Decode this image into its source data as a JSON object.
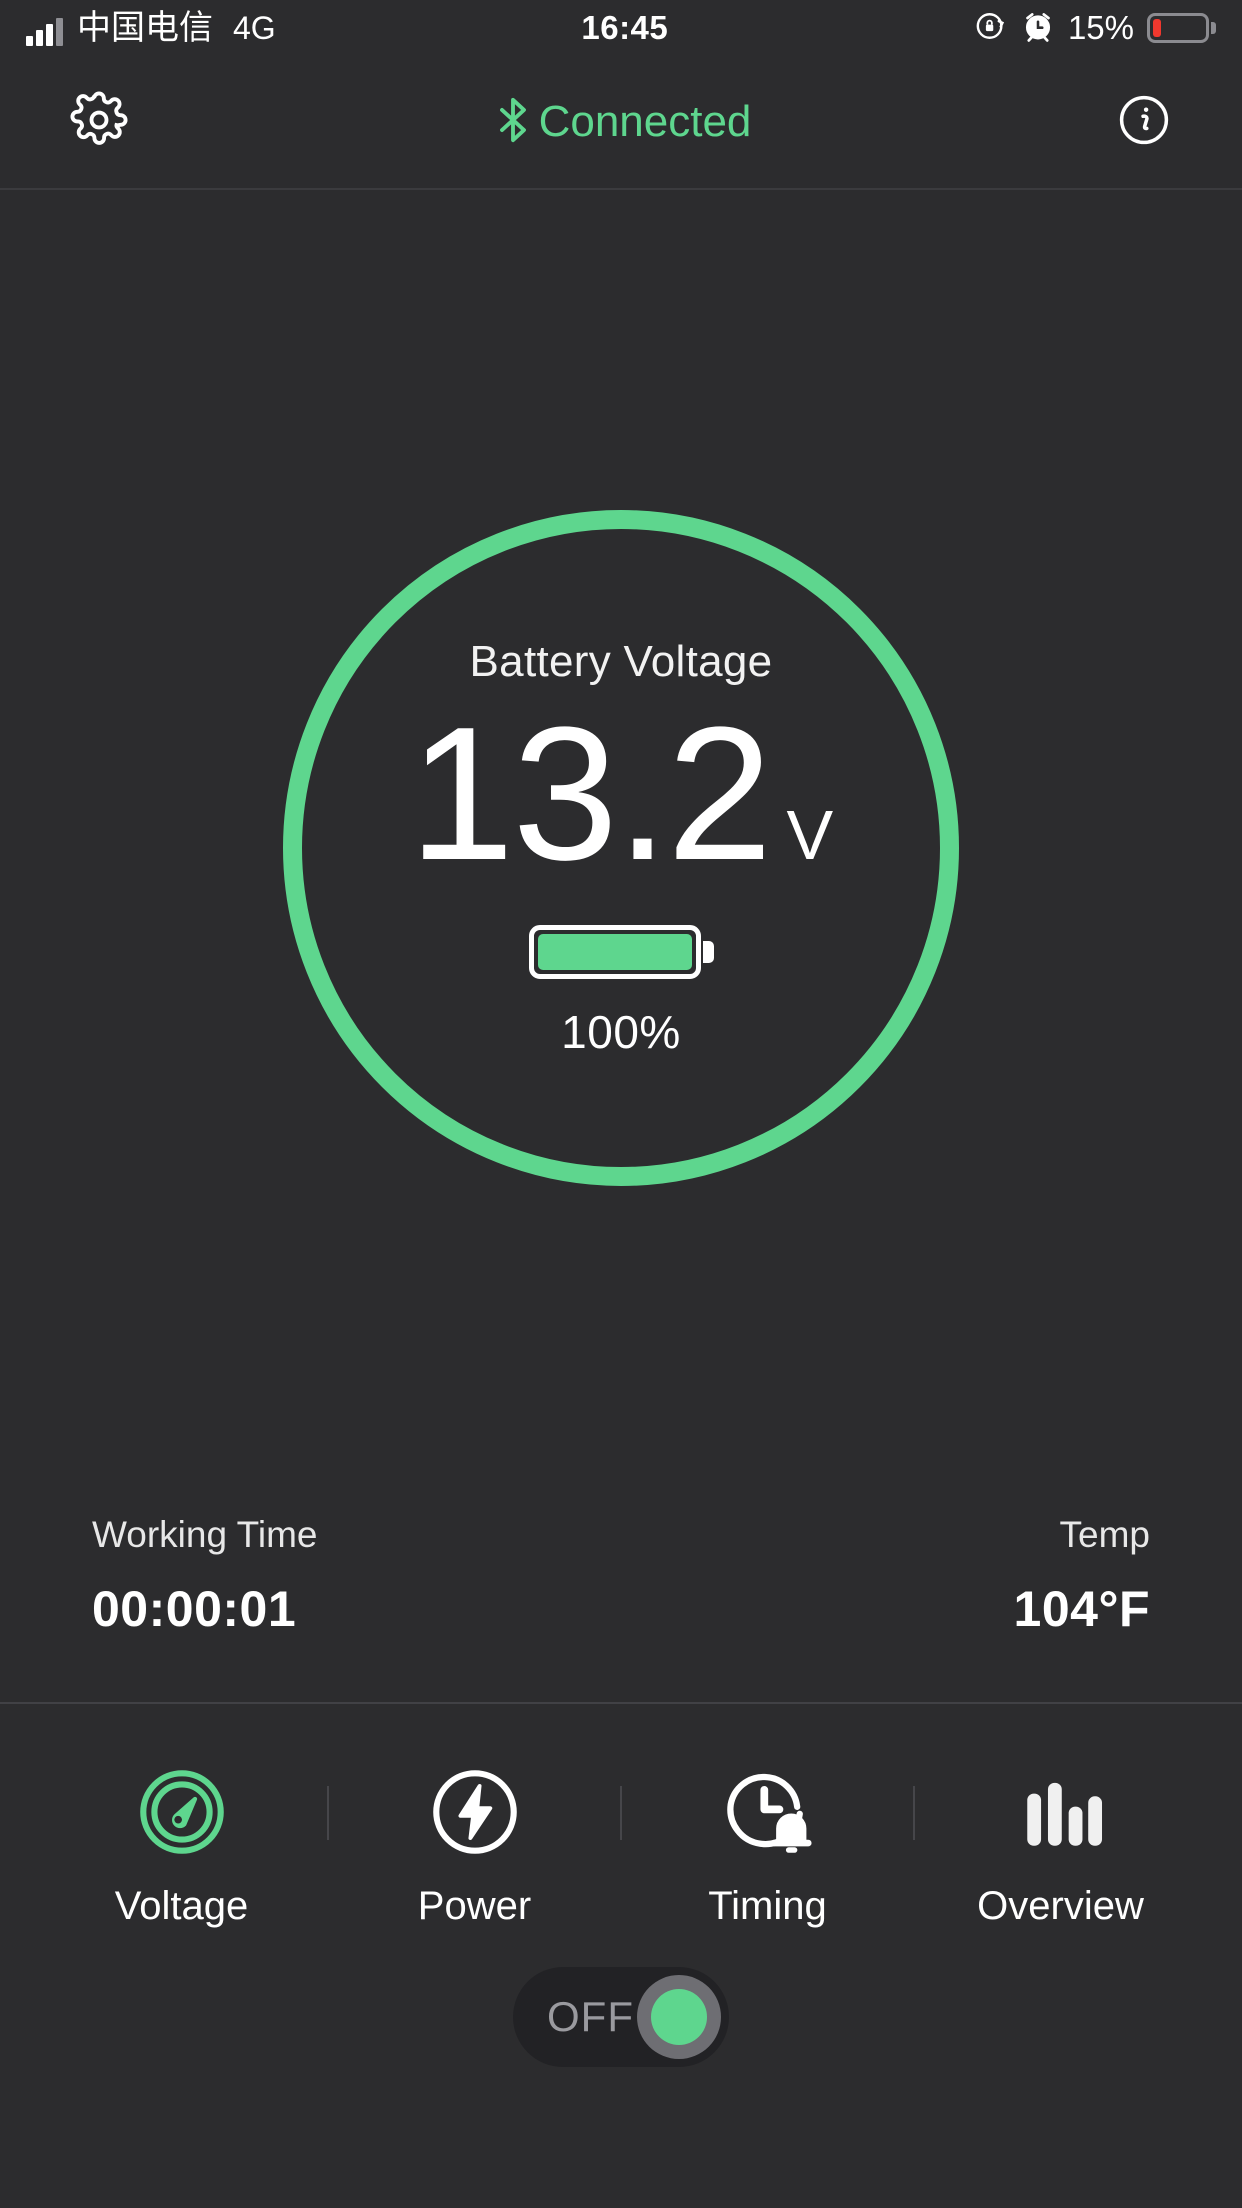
{
  "statusbar": {
    "carrier": "中国电信",
    "network": "4G",
    "time": "16:45",
    "battery_percent": "15%",
    "battery_level": 15,
    "signal_bars": 3,
    "icons": [
      "signal-bars-icon",
      "rotation-lock-icon",
      "alarm-clock-icon",
      "battery-icon"
    ]
  },
  "header": {
    "settings_icon": "gear-icon",
    "bluetooth_icon": "bluetooth-icon",
    "status_label": "Connected",
    "info_icon": "info-icon",
    "accent_color": "#5ed68e"
  },
  "gauge": {
    "caption": "Battery Voltage",
    "value": "13.2",
    "unit": "V",
    "battery_percent_label": "100%",
    "battery_fill": 100,
    "ring_color": "#5ed68e"
  },
  "stats": [
    {
      "label": "Working Time",
      "value": "00:00:01"
    },
    {
      "label": "Temp",
      "value": "104°F"
    }
  ],
  "tabs": [
    {
      "label": "Voltage",
      "icon": "gauge-icon",
      "active": true
    },
    {
      "label": "Power",
      "icon": "bolt-icon",
      "active": false
    },
    {
      "label": "Timing",
      "icon": "clock-alarm-icon",
      "active": false
    },
    {
      "label": "Overview",
      "icon": "bar-chart-icon",
      "active": false
    }
  ],
  "power_switch": {
    "label": "OFF",
    "state": "off",
    "knob_color": "#5ed68e"
  }
}
